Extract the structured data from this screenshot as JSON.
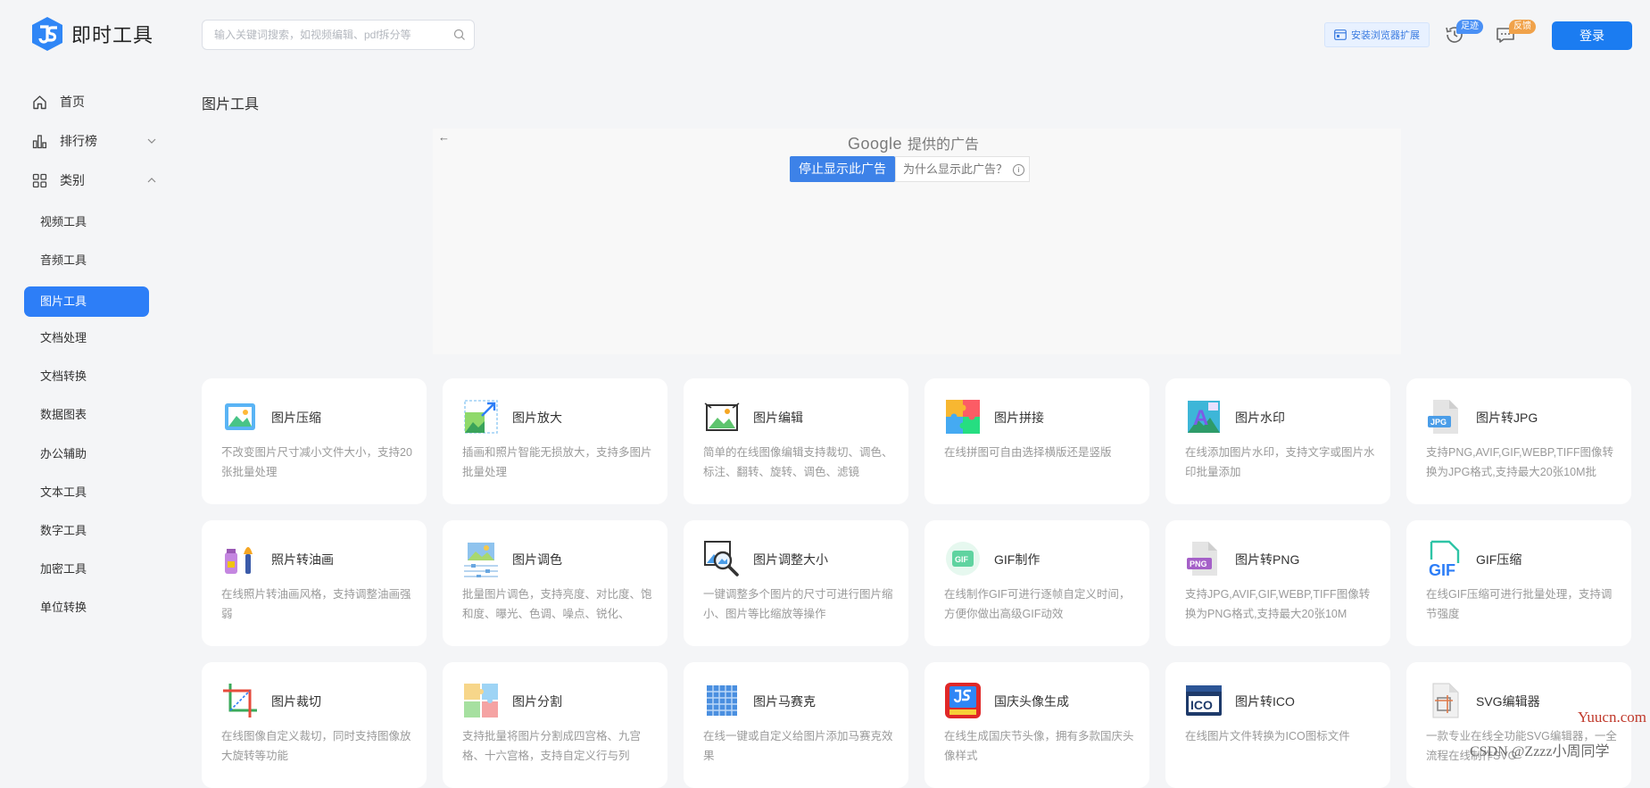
{
  "app": {
    "logo_text": "即时工具",
    "search_placeholder": "输入关键词搜索，如视频编辑、pdf拆分等",
    "install_extension": "安装浏览器扩展",
    "footprint_badge": "足迹",
    "feedback_badge": "反馈",
    "login": "登录",
    "accent_color": "#1b7cf1"
  },
  "sidebar": {
    "top_items": [
      {
        "label": "首页",
        "icon": "home-icon"
      },
      {
        "label": "排行榜",
        "icon": "chart-icon"
      },
      {
        "label": "类别",
        "icon": "grid-icon"
      }
    ],
    "categories": [
      {
        "label": "视频工具",
        "active": false
      },
      {
        "label": "音频工具",
        "active": false
      },
      {
        "label": "图片工具",
        "active": true
      },
      {
        "label": "文档处理",
        "active": false
      },
      {
        "label": "文档转换",
        "active": false
      },
      {
        "label": "数据图表",
        "active": false
      },
      {
        "label": "办公辅助",
        "active": false
      },
      {
        "label": "文本工具",
        "active": false
      },
      {
        "label": "数字工具",
        "active": false
      },
      {
        "label": "加密工具",
        "active": false
      },
      {
        "label": "单位转换",
        "active": false
      }
    ]
  },
  "main": {
    "title": "图片工具",
    "ad": {
      "google": "Google",
      "provided": "提供的广告",
      "stop": "停止显示此广告",
      "why": "为什么显示此广告？"
    },
    "tools": [
      {
        "title": "图片压缩",
        "desc": "不改变图片尺寸减小文件大小，支持20张批量处理",
        "icon": "image-compress-icon"
      },
      {
        "title": "图片放大",
        "desc": "插画和照片智能无损放大，支持多图片批量处理",
        "icon": "image-enlarge-icon"
      },
      {
        "title": "图片编辑",
        "desc": "简单的在线图像编辑支持裁切、调色、标注、翻转、旋转、调色、滤镜",
        "icon": "image-edit-icon"
      },
      {
        "title": "图片拼接",
        "desc": "在线拼图可自由选择横版还是竖版",
        "icon": "puzzle-icon"
      },
      {
        "title": "图片水印",
        "desc": "在线添加图片水印，支持文字或图片水印批量添加",
        "icon": "watermark-icon"
      },
      {
        "title": "图片转JPG",
        "desc": "支持PNG,AVIF,GIF,WEBP,TIFF图像转换为JPG格式,支持最大20张10M批",
        "icon": "jpg-file-icon"
      },
      {
        "title": "照片转油画",
        "desc": "在线照片转油画风格，支持调整油画强弱",
        "icon": "paint-brush-icon"
      },
      {
        "title": "图片调色",
        "desc": "批量图片调色，支持亮度、对比度、饱和度、曝光、色调、噪点、锐化、",
        "icon": "color-adjust-icon"
      },
      {
        "title": "图片调整大小",
        "desc": "一键调整多个图片的尺寸可进行图片缩小、图片等比缩放等操作",
        "icon": "resize-magnifier-icon"
      },
      {
        "title": "GIF制作",
        "desc": "在线制作GIF可进行逐帧自定义时间，方便你做出高级GIF动效",
        "icon": "gif-make-icon"
      },
      {
        "title": "图片转PNG",
        "desc": "支持JPG,AVIF,GIF,WEBP,TIFF图像转换为PNG格式,支持最大20张10M",
        "icon": "png-file-icon"
      },
      {
        "title": "GIF压缩",
        "desc": "在线GIF压缩可进行批量处理，支持调节强度",
        "icon": "gif-compress-icon"
      },
      {
        "title": "图片裁切",
        "desc": "在线图像自定义裁切，同时支持图像放大旋转等功能",
        "icon": "crop-icon"
      },
      {
        "title": "图片分割",
        "desc": "支持批量将图片分割成四宫格、九宫格、十六宫格，支持自定义行与列",
        "icon": "split-icon"
      },
      {
        "title": "图片马赛克",
        "desc": "在线一键或自定义给图片添加马赛克效果",
        "icon": "mosaic-icon"
      },
      {
        "title": "国庆头像生成",
        "desc": "在线生成国庆节头像，拥有多款国庆头像样式",
        "icon": "national-day-avatar-icon"
      },
      {
        "title": "图片转ICO",
        "desc": "在线图片文件转换为ICO图标文件",
        "icon": "ico-file-icon"
      },
      {
        "title": "SVG编辑器",
        "desc": "一款专业在线全功能SVG编辑器，一全流程在线制作SVG",
        "icon": "svg-editor-icon"
      }
    ]
  },
  "overlay": {
    "site_watermark": "Yuucn.com",
    "csdn_watermark": "CSDN @Zzzz小周同学"
  }
}
